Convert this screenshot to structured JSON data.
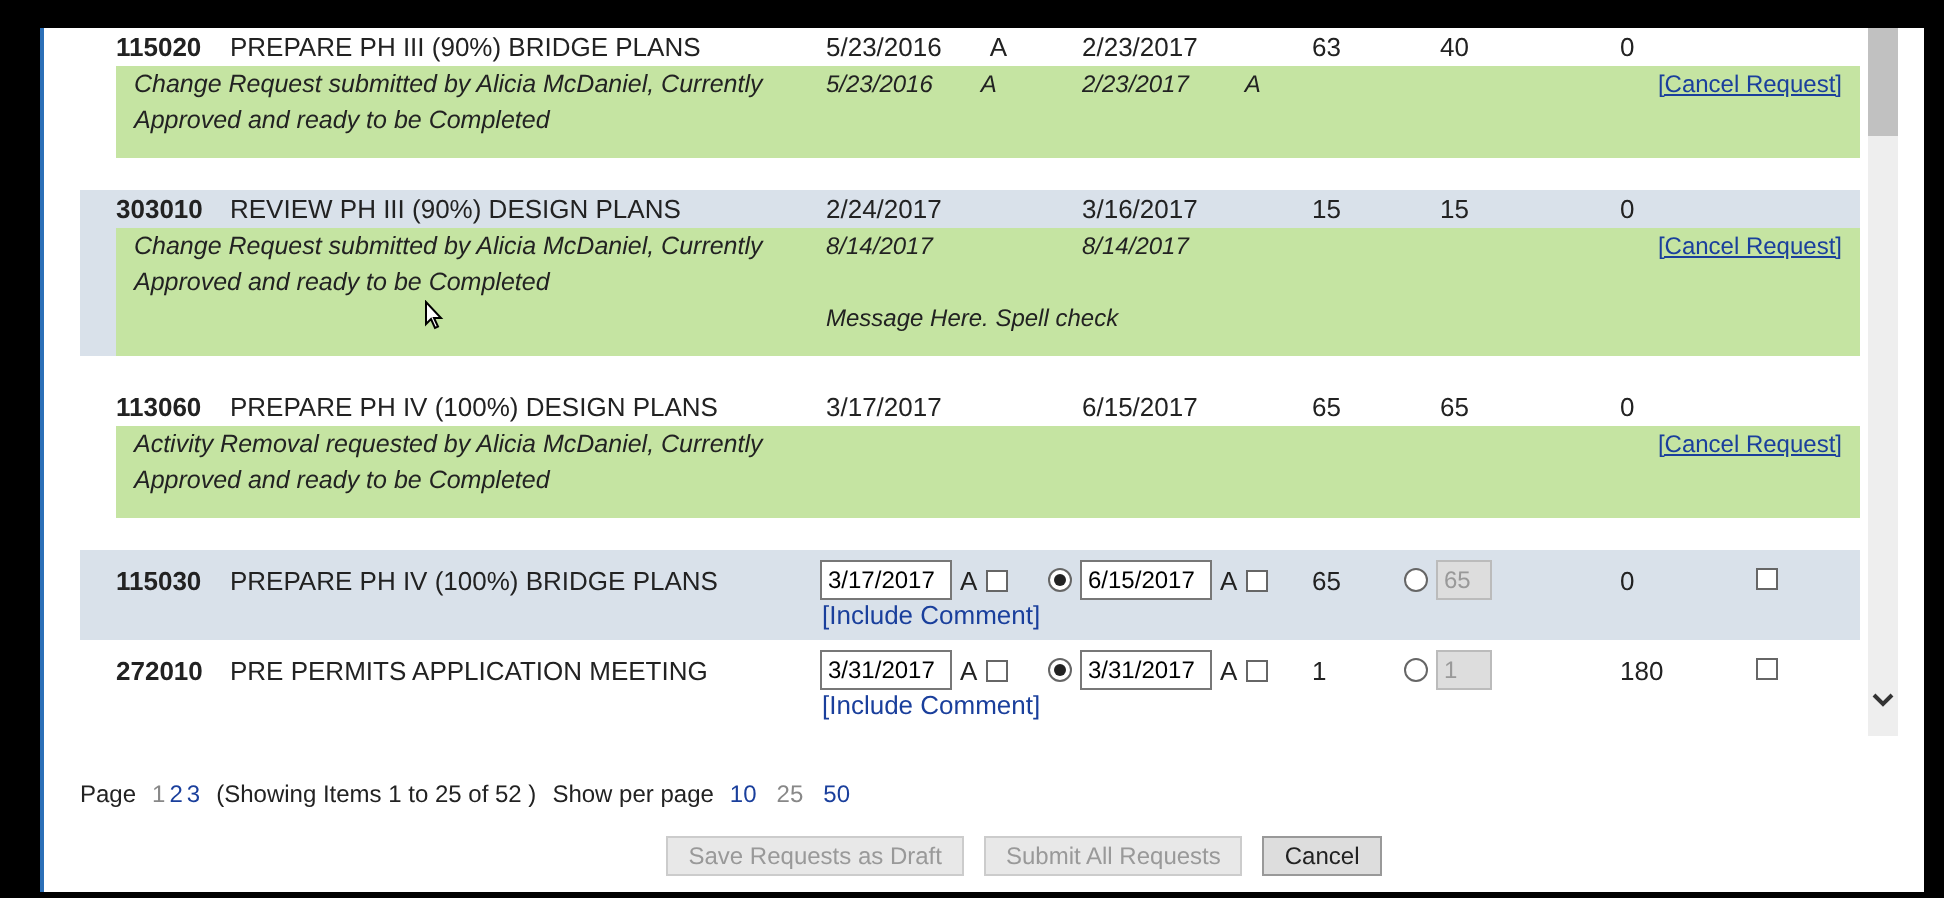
{
  "rows": [
    {
      "kind": "pending",
      "id": "115020",
      "name": "PREPARE PH III (90%) BRIDGE PLANS",
      "start": "5/23/2016",
      "start_flag": "A",
      "finish": "2/23/2017",
      "duration": "63",
      "col_6": "40",
      "col_7": "0",
      "request": {
        "note": "Change Request submitted by Alicia McDaniel, Currently Approved and ready to be Completed",
        "start": "5/23/2016",
        "start_flag": "A",
        "finish": "2/23/2017",
        "finish_flag": "A",
        "link": "[Cancel Request]"
      }
    },
    {
      "kind": "pending",
      "id": "303010",
      "name": "REVIEW PH III (90%) DESIGN PLANS",
      "start": "2/24/2017",
      "finish": "3/16/2017",
      "duration": "15",
      "col_6": "15",
      "col_7": "0",
      "request": {
        "note": "Change Request submitted by Alicia McDaniel, Currently Approved and ready to be Completed",
        "start": "8/14/2017",
        "finish": "8/14/2017",
        "message": "Message Here. Spell check",
        "link": "[Cancel Request]"
      }
    },
    {
      "kind": "pending",
      "id": "113060",
      "name": "PREPARE PH IV (100%) DESIGN PLANS",
      "start": "3/17/2017",
      "finish": "6/15/2017",
      "duration": "65",
      "col_6": "65",
      "col_7": "0",
      "request": {
        "note": "Activity Removal requested by Alicia McDaniel, Currently Approved and ready to be Completed",
        "link": "[Cancel Request]"
      }
    },
    {
      "kind": "editable",
      "id": "115030",
      "name": "PREPARE PH IV (100%) BRIDGE PLANS",
      "start": "3/17/2017",
      "start_flag": "A",
      "start_checked": false,
      "finish_selected": true,
      "finish": "6/15/2017",
      "finish_flag": "A",
      "finish_checked": false,
      "duration": "65",
      "col_6_selected": false,
      "col_6": "65",
      "col_7": "0",
      "checked": false,
      "comment_link": "[Include Comment]"
    },
    {
      "kind": "editable",
      "id": "272010",
      "name": "PRE PERMITS APPLICATION MEETING",
      "start": "3/31/2017",
      "start_flag": "A",
      "start_checked": false,
      "finish_selected": true,
      "finish": "3/31/2017",
      "finish_flag": "A",
      "finish_checked": false,
      "duration": "1",
      "col_6_selected": false,
      "col_6": "1",
      "col_7": "180",
      "checked": false,
      "comment_link": "[Include Comment]"
    }
  ],
  "pager": {
    "label": "Page",
    "pages": [
      {
        "label": "1",
        "selected": true
      },
      {
        "label": "2",
        "selected": false
      },
      {
        "label": "3",
        "selected": false
      }
    ],
    "summary": "(Showing Items 1 to 25 of 52 )",
    "per_page_label": "Show per page",
    "per_page": [
      {
        "label": "10",
        "selected": false
      },
      {
        "label": "25",
        "selected": true
      },
      {
        "label": "50",
        "selected": false
      }
    ]
  },
  "buttons": [
    {
      "label": "Save Requests as Draft",
      "disabled": true
    },
    {
      "label": "Submit All Requests",
      "disabled": true
    },
    {
      "label": "Cancel",
      "disabled": false
    }
  ]
}
